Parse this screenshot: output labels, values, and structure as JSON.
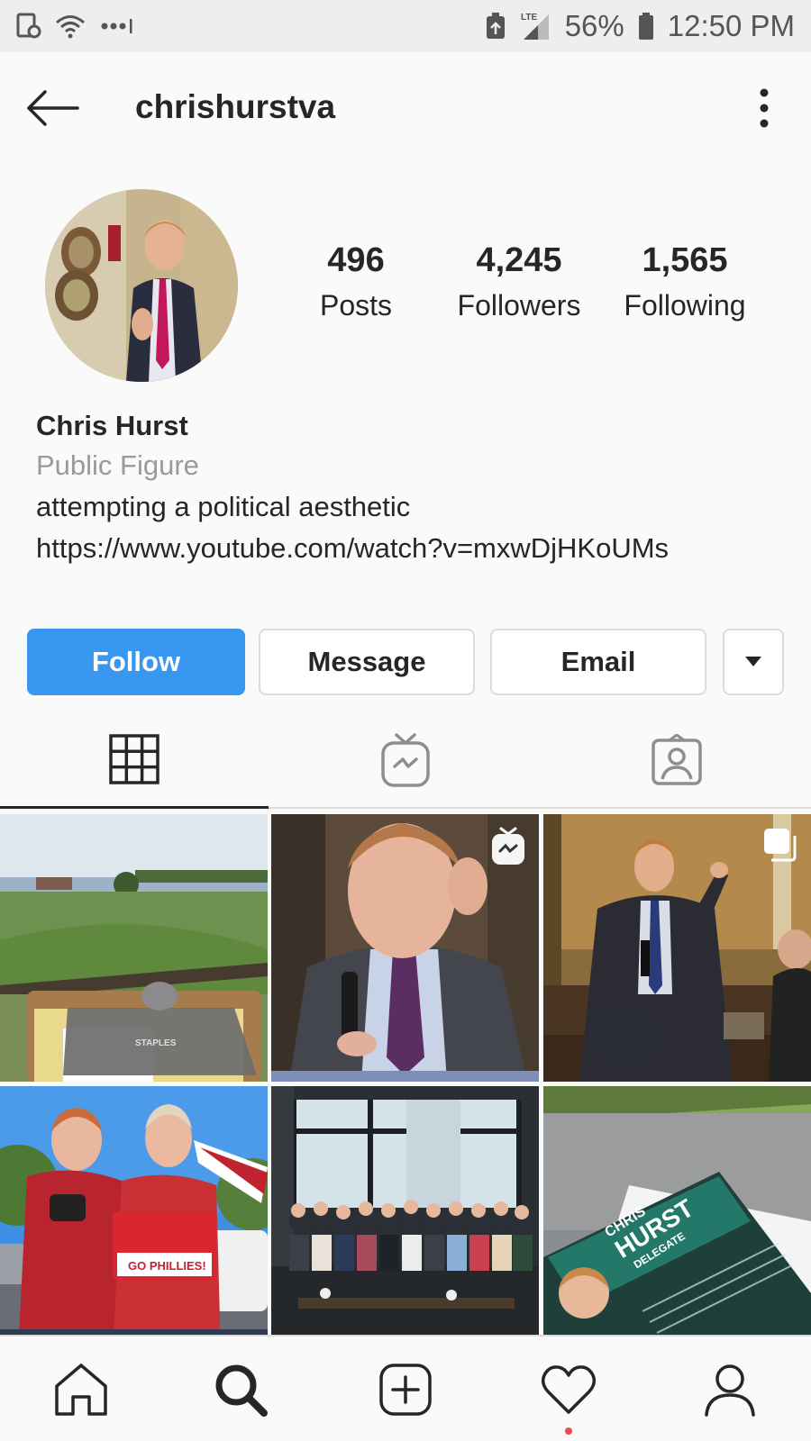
{
  "status_bar": {
    "battery": "56%",
    "time": "12:50 PM",
    "network": "LTE"
  },
  "header": {
    "username": "chrishurstva"
  },
  "profile": {
    "stats": [
      {
        "value": "496",
        "label": "Posts"
      },
      {
        "value": "4,245",
        "label": "Followers"
      },
      {
        "value": "1,565",
        "label": "Following"
      }
    ],
    "name": "Chris Hurst",
    "category": "Public Figure",
    "bio": "attempting a political aesthetic",
    "link": "https://www.youtube.com/watch?v=mxwDjHKoUMs"
  },
  "actions": {
    "follow": "Follow",
    "message": "Message",
    "email": "Email"
  },
  "tabs": [
    "grid-icon",
    "igtv-icon",
    "tagged-icon"
  ],
  "photos": {
    "photo_1_clipboard_text": "STAPLES",
    "photo_4_sign_text": "GO PHILLIES!",
    "photo_6_card_name": "CHRIS",
    "photo_6_card_surname": "HURST",
    "photo_6_card_role": "DELEGATE"
  },
  "bottom_nav": [
    "home-icon",
    "search-icon",
    "add-post-icon",
    "activity-heart-icon",
    "profile-icon"
  ],
  "colors": {
    "accent": "#3897f0",
    "text": "#262626",
    "muted": "#9a9a9a",
    "notification": "#ed4956"
  }
}
